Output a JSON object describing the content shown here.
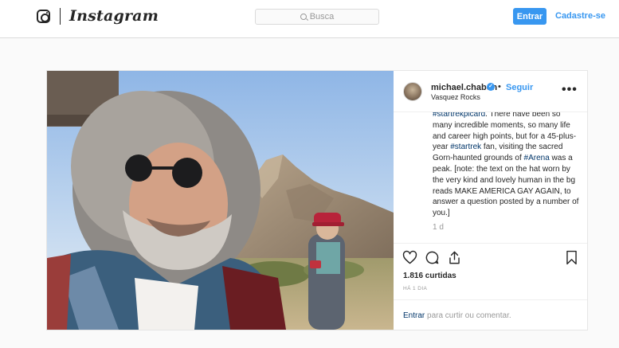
{
  "header": {
    "wordmark": "Instagram",
    "search_placeholder": "Busca",
    "login_label": "Entrar",
    "signup_label": "Cadastre-se"
  },
  "post": {
    "username": "michael.chabon",
    "dot": "•",
    "follow_label": "Seguir",
    "location": "Vasquez Rocks",
    "more_label": "•••",
    "caption_parts": [
      {
        "tag": true,
        "text": "#startrekpicard"
      },
      {
        "tag": false,
        "text": ". There have been so many incredible moments, so many life and career high points, but for a 45-plus-year "
      },
      {
        "tag": true,
        "text": "#startrek"
      },
      {
        "tag": false,
        "text": " fan, visiting the sacred Gorn-haunted grounds of "
      },
      {
        "tag": true,
        "text": "#Arena"
      },
      {
        "tag": false,
        "text": " was a peak. [note: the text on the hat worn by the very kind and lovely human in the bg reads MAKE AMERICA GAY AGAIN, to answer a question posted by a number of you.]"
      }
    ],
    "age": "1 d",
    "likes": "1.816 curtidas",
    "time": "HÁ 1 DIA",
    "comment_prompt_link": "Entrar",
    "comment_prompt_rest": "para curtir ou comentar."
  },
  "colors": {
    "accent": "#3897f0",
    "link": "#003569",
    "muted": "#999999"
  },
  "icons": [
    "instagram-glyph-icon",
    "search-icon",
    "verified-badge-icon",
    "more-options-icon",
    "heart-icon",
    "comment-icon",
    "share-icon",
    "bookmark-icon"
  ]
}
